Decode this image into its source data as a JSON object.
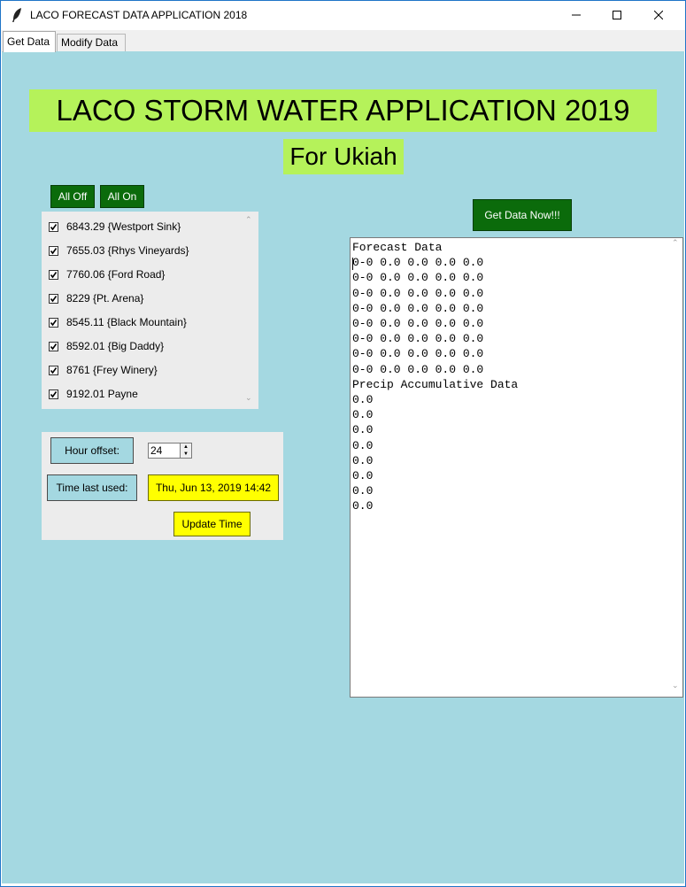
{
  "window": {
    "title": "LACO FORECAST DATA APPLICATION 2018",
    "controls": {
      "minimize": "minimize-icon",
      "maximize": "maximize-icon",
      "close": "close-icon"
    }
  },
  "tabs": [
    {
      "label": "Get Data",
      "active": true
    },
    {
      "label": "Modify Data",
      "active": false
    }
  ],
  "header": {
    "title": "LACO STORM WATER APPLICATION 2019",
    "subtitle": "For Ukiah"
  },
  "controls": {
    "all_off": "All Off",
    "all_on": "All On",
    "get_data_now": "Get Data Now!!!"
  },
  "stations": [
    {
      "label": "6843.29 {Westport Sink}",
      "checked": true
    },
    {
      "label": "7655.03 {Rhys Vineyards}",
      "checked": true
    },
    {
      "label": "7760.06 {Ford Road}",
      "checked": true
    },
    {
      "label": "8229 {Pt. Arena}",
      "checked": true
    },
    {
      "label": "8545.11 {Black Mountain}",
      "checked": true
    },
    {
      "label": "8592.01 {Big Daddy}",
      "checked": true
    },
    {
      "label": "8761 {Frey Winery}",
      "checked": true
    },
    {
      "label": "9192.01 Payne",
      "checked": true
    }
  ],
  "time": {
    "hour_offset_label": "Hour offset:",
    "hour_offset_value": "24",
    "time_last_used_label": "Time last used:",
    "time_last_used_value": "Thu, Jun 13, 2019 14:42",
    "update_button": "Update Time"
  },
  "output": {
    "lines": [
      "Forecast Data",
      "0-0 0.0 0.0 0.0 0.0",
      "0-0 0.0 0.0 0.0 0.0",
      "0-0 0.0 0.0 0.0 0.0",
      "0-0 0.0 0.0 0.0 0.0",
      "0-0 0.0 0.0 0.0 0.0",
      "0-0 0.0 0.0 0.0 0.0",
      "0-0 0.0 0.0 0.0 0.0",
      "0-0 0.0 0.0 0.0 0.0",
      "Precip Accumulative Data",
      "0.0",
      "0.0",
      "0.0",
      "0.0",
      "0.0",
      "0.0",
      "0.0",
      "0.0"
    ]
  },
  "colors": {
    "background": "#a4d8e1",
    "banner": "#b5f25a",
    "green_button": "#0b6b0b",
    "yellow": "#ffff00",
    "panel": "#ececec"
  }
}
